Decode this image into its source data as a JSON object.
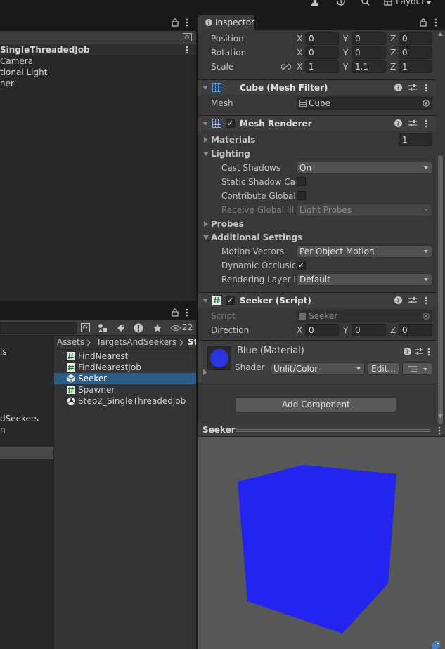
{
  "toolbar": {
    "icons": [
      "account-icon",
      "history-icon",
      "search-icon",
      "layout-icon"
    ],
    "layout_label": "Layout"
  },
  "hierarchy": {
    "rows": [
      "SingleThreadedJob",
      "Camera",
      "tional Light",
      "ner"
    ]
  },
  "project": {
    "search_value": "",
    "hidden_count": "22",
    "folders": [
      "ls",
      "dSeekers",
      "n"
    ],
    "breadcrumb": [
      "Assets",
      "TargetsAndSeekers",
      "St"
    ],
    "assets": [
      {
        "name": "FindNearest",
        "icon": "script-icon"
      },
      {
        "name": "FindNearestJob",
        "icon": "script-icon"
      },
      {
        "name": "Seeker",
        "icon": "prefab-icon"
      },
      {
        "name": "Spawner",
        "icon": "script-icon"
      },
      {
        "name": "Step2_SingleThreadedJob",
        "icon": "unity-scene-icon"
      }
    ]
  },
  "inspector": {
    "tab_label": "Inspector",
    "transform": {
      "position": {
        "label": "Position",
        "x": "0",
        "y": "0",
        "z": "0"
      },
      "rotation": {
        "label": "Rotation",
        "x": "0",
        "y": "0",
        "z": "0"
      },
      "scale": {
        "label": "Scale",
        "x": "1",
        "y": "1.1",
        "z": "1"
      }
    },
    "mesh_filter": {
      "title": "Cube (Mesh Filter)",
      "mesh_label": "Mesh",
      "mesh_value": "Cube"
    },
    "mesh_renderer": {
      "title": "Mesh Renderer",
      "enabled": true,
      "materials_label": "Materials",
      "materials_count": "1",
      "lighting_label": "Lighting",
      "cast_shadows_label": "Cast Shadows",
      "cast_shadows_value": "On",
      "static_shadow_label": "Static Shadow Cas",
      "contribute_gi_label": "Contribute Global",
      "receive_gi_label": "Receive Global Illu",
      "receive_gi_value": "Light Probes",
      "probes_label": "Probes",
      "additional_label": "Additional Settings",
      "motion_vectors_label": "Motion Vectors",
      "motion_vectors_value": "Per Object Motion",
      "dynamic_occlusion_label": "Dynamic Occlusior",
      "dynamic_occlusion_checked": true,
      "rendering_layer_label": "Rendering Layer M",
      "rendering_layer_value": "Default"
    },
    "seeker_script": {
      "title": "Seeker (Script)",
      "enabled": true,
      "script_label": "Script",
      "script_value": "Seeker",
      "direction_label": "Direction",
      "x": "0",
      "y": "0",
      "z": "0"
    },
    "material": {
      "title": "Blue (Material)",
      "shader_label": "Shader",
      "shader_value": "Unlit/Color",
      "edit_label": "Edit...",
      "swatch_color": "#2a35e0"
    },
    "add_component_label": "Add Component",
    "axis_labels": {
      "x": "X",
      "y": "Y",
      "z": "Z"
    }
  },
  "preview": {
    "title": "Seeker",
    "cube_color": "#2424f0",
    "background_color": "#575757"
  }
}
